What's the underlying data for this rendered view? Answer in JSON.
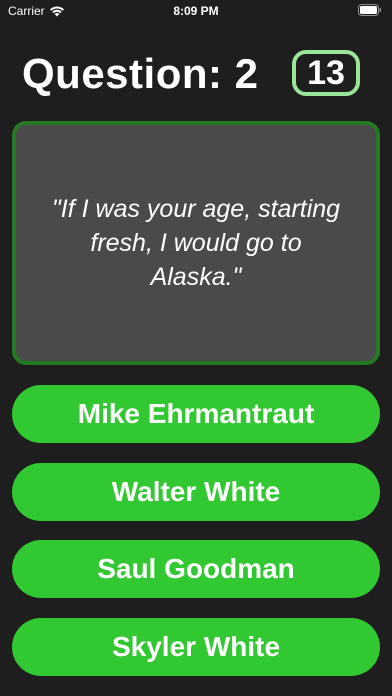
{
  "status_bar": {
    "carrier": "Carrier",
    "time": "8:09 PM",
    "wifi_icon": "wifi-icon",
    "battery_icon": "battery-icon"
  },
  "header": {
    "question_label": "Question: 2",
    "timer": "13"
  },
  "quote": {
    "text": "\"If I was your age, starting fresh, I would go to Alaska.\""
  },
  "answers": [
    {
      "label": "Mike Ehrmantraut"
    },
    {
      "label": "Walter White"
    },
    {
      "label": "Saul Goodman"
    },
    {
      "label": "Skyler White"
    }
  ],
  "colors": {
    "background": "#1e1e1e",
    "answer_button": "#32c832",
    "quote_card": "#4a4a4a",
    "quote_border": "#237a23",
    "timer_border": "#9be59b"
  }
}
